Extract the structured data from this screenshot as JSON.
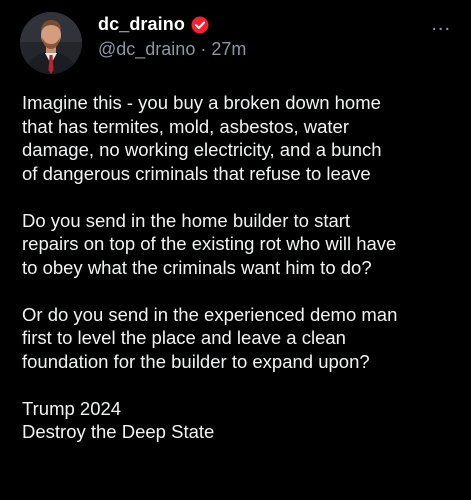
{
  "author": {
    "display_name": "dc_draino",
    "handle": "@dc_draino",
    "separator": "·",
    "time": "27m",
    "verified_icon": "verified-badge-icon",
    "verified_color": "#f4212e"
  },
  "more_menu": {
    "label": "..."
  },
  "post": {
    "paragraphs": [
      {
        "lines": [
          "Imagine this - you buy a broken down home",
          "that has termites, mold, asbestos, water",
          "damage, no working electricity, and a bunch",
          "of dangerous criminals that refuse to leave"
        ]
      },
      {
        "lines": [
          "Do you send in the home builder to start",
          "repairs on top of the existing rot who will have",
          "to obey what the criminals want him to do?"
        ]
      },
      {
        "lines": [
          "Or do you send in the experienced demo man",
          "first to level the place and leave a clean",
          "foundation for the builder to expand upon?"
        ]
      },
      {
        "lines": [
          "Trump 2024",
          "Destroy the Deep State"
        ]
      }
    ]
  },
  "colors": {
    "background": "#000000",
    "text": "#f1f3f4",
    "secondary_text": "#8b98a5"
  }
}
